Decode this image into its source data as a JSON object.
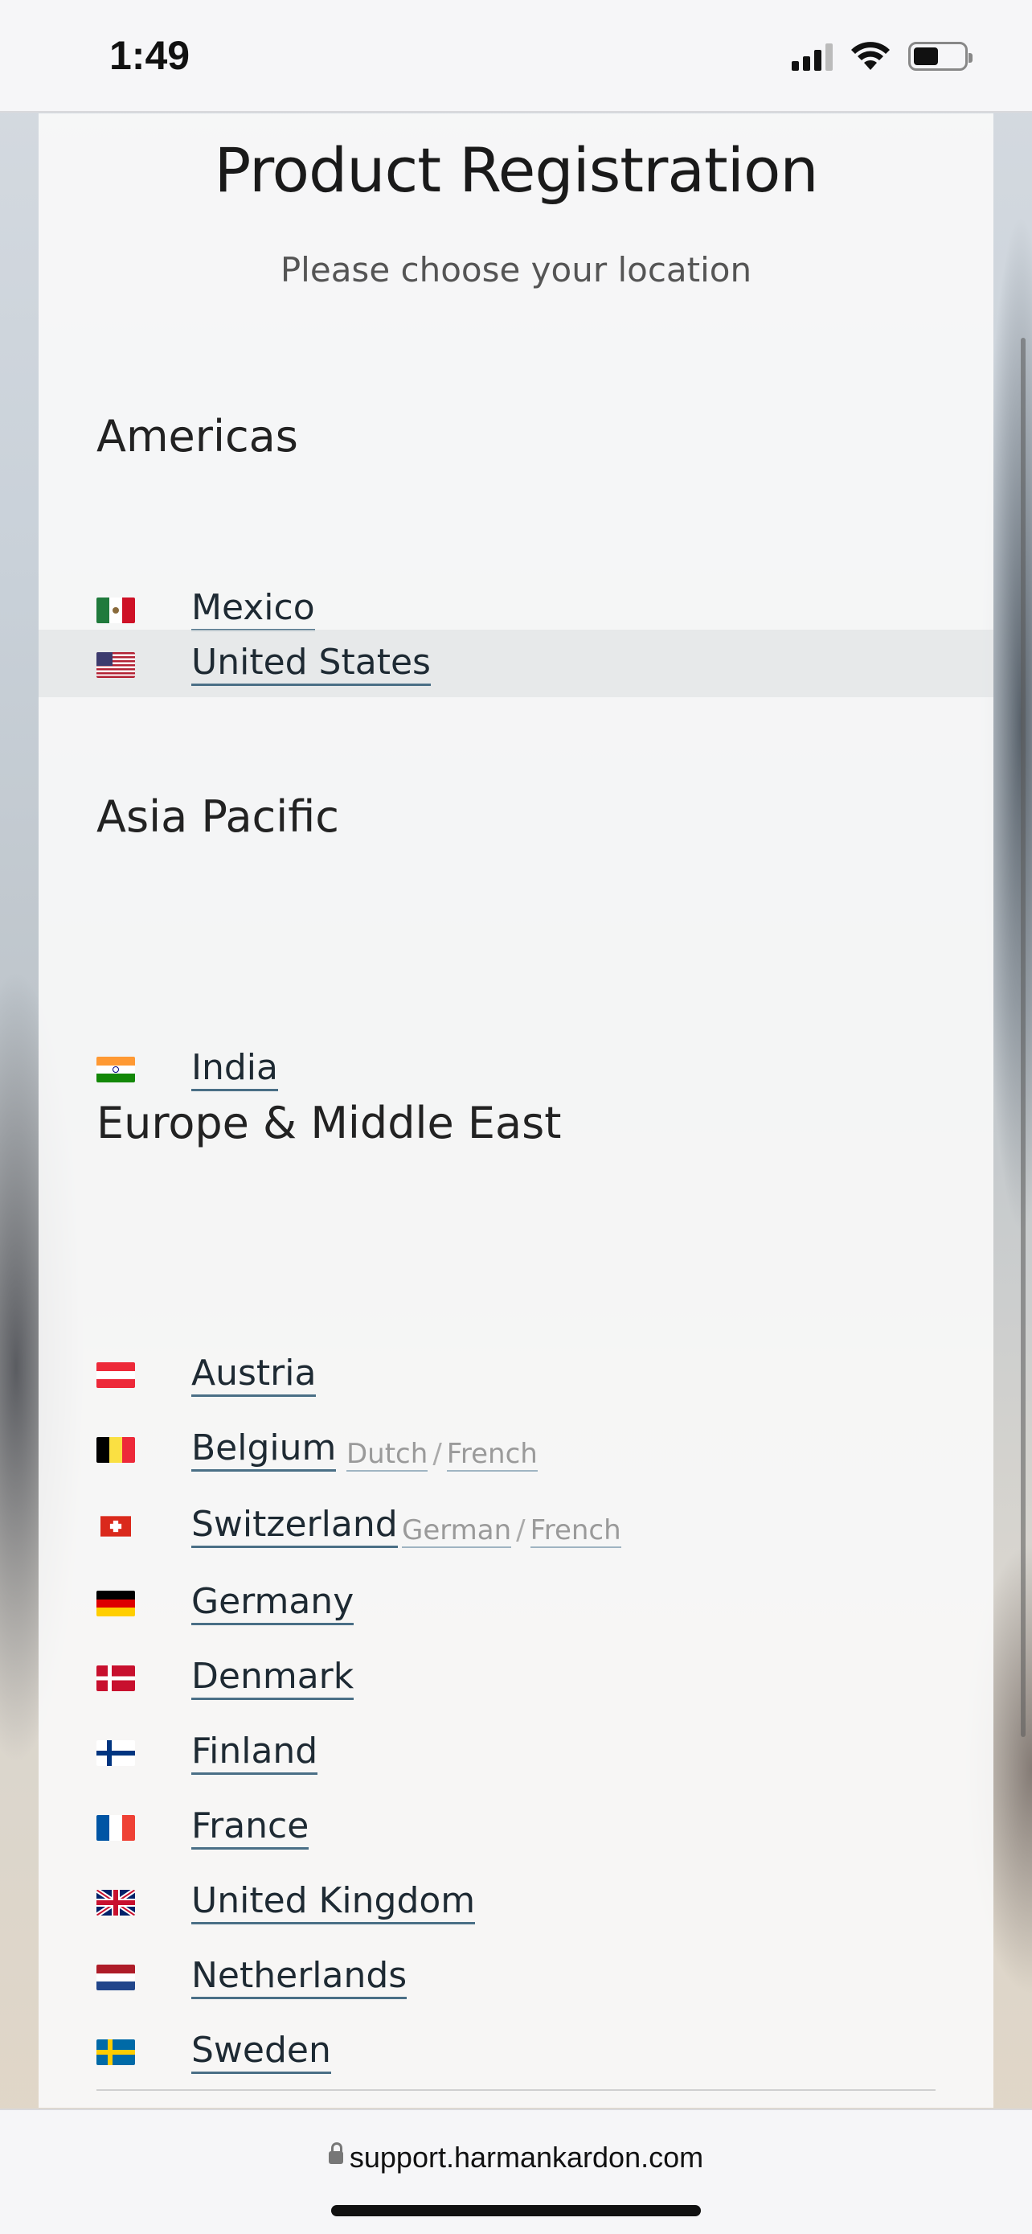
{
  "status": {
    "time": "1:49"
  },
  "page": {
    "title": "Product Registration",
    "subtitle": "Please choose your location"
  },
  "regions": {
    "americas": {
      "heading": "Americas",
      "countries": [
        {
          "name": "Mexico",
          "flag": "mexico-flag"
        },
        {
          "name": "United States",
          "flag": "us-flag"
        }
      ]
    },
    "asia_pacific": {
      "heading": "Asia Pacific",
      "countries": [
        {
          "name": "India",
          "flag": "india-flag"
        }
      ]
    },
    "europe": {
      "heading": "Europe & Middle East",
      "countries": [
        {
          "name": "Austria",
          "flag": "austria-flag"
        },
        {
          "name": "Belgium",
          "flag": "belgium-flag",
          "languages": [
            "Dutch",
            "French"
          ]
        },
        {
          "name": "Switzerland",
          "flag": "switzerland-flag",
          "languages": [
            "German",
            "French"
          ]
        },
        {
          "name": "Germany",
          "flag": "germany-flag"
        },
        {
          "name": "Denmark",
          "flag": "denmark-flag"
        },
        {
          "name": "Finland",
          "flag": "finland-flag"
        },
        {
          "name": "France",
          "flag": "france-flag"
        },
        {
          "name": "United Kingdom",
          "flag": "uk-flag"
        },
        {
          "name": "Netherlands",
          "flag": "netherlands-flag"
        },
        {
          "name": "Sweden",
          "flag": "sweden-flag"
        }
      ]
    }
  },
  "language_separator": "/",
  "browser": {
    "url": "support.harmankardon.com"
  }
}
